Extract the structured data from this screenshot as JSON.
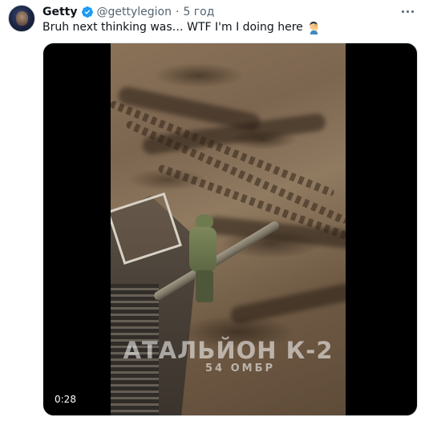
{
  "tweet": {
    "author_name": "Getty",
    "handle": "@gettylegion",
    "separator": "·",
    "time": "5 год",
    "text": "Bruh next thinking was… WTF I'm I doing here",
    "emoji": "man-facepalming-emoji"
  },
  "media": {
    "type": "video",
    "duration": "0:28",
    "overlay_line1": "АТАЛЬЙОН К-2",
    "overlay_line2": "54 ОМБР"
  },
  "colors": {
    "verified_badge": "#1d9bf0",
    "secondary_text": "#536471",
    "primary_text": "#0f1419"
  },
  "icons": {
    "verified": "verified-badge-icon",
    "more": "more-options-icon"
  }
}
